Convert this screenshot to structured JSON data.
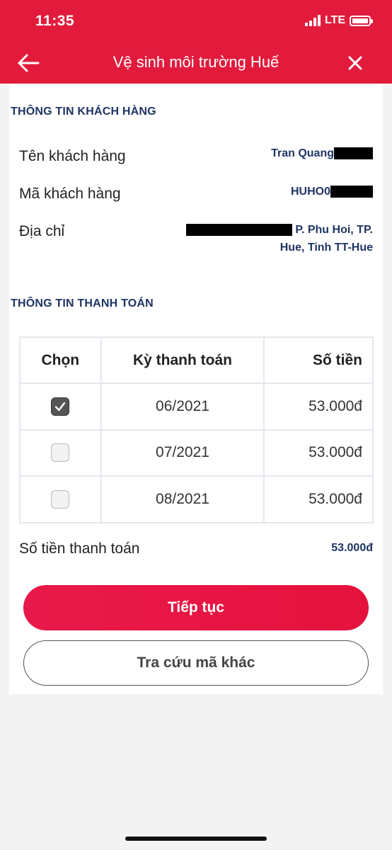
{
  "status_bar": {
    "time": "11:35",
    "network": "LTE"
  },
  "nav": {
    "title": "Vệ sinh môi trường Huế"
  },
  "customer": {
    "section_title": "THÔNG TIN KHÁCH HÀNG",
    "name_label": "Tên khách hàng",
    "name_value": "Tran Quang",
    "id_label": "Mã khách hàng",
    "id_value": "HUHO0",
    "address_label": "Địa chỉ",
    "address_line1": "P. Phu Hoi, TP.",
    "address_line2": "Hue, Tinh TT-Hue"
  },
  "payment": {
    "section_title": "THÔNG TIN THANH TOÁN",
    "headers": {
      "select": "Chọn",
      "period": "Kỳ thanh toán",
      "amount": "Số tiền"
    },
    "rows": [
      {
        "period": "06/2021",
        "amount": "53.000đ",
        "checked": true
      },
      {
        "period": "07/2021",
        "amount": "53.000đ",
        "checked": false
      },
      {
        "period": "08/2021",
        "amount": "53.000đ",
        "checked": false
      }
    ],
    "total_label": "Số tiền thanh toán",
    "total_value": "53.000đ"
  },
  "actions": {
    "continue_label": "Tiếp tục",
    "lookup_other_label": "Tra cứu mã khác"
  },
  "colors": {
    "brand": "#e21b3c",
    "label_navy": "#1e3564",
    "background": "#f3f3f3"
  }
}
